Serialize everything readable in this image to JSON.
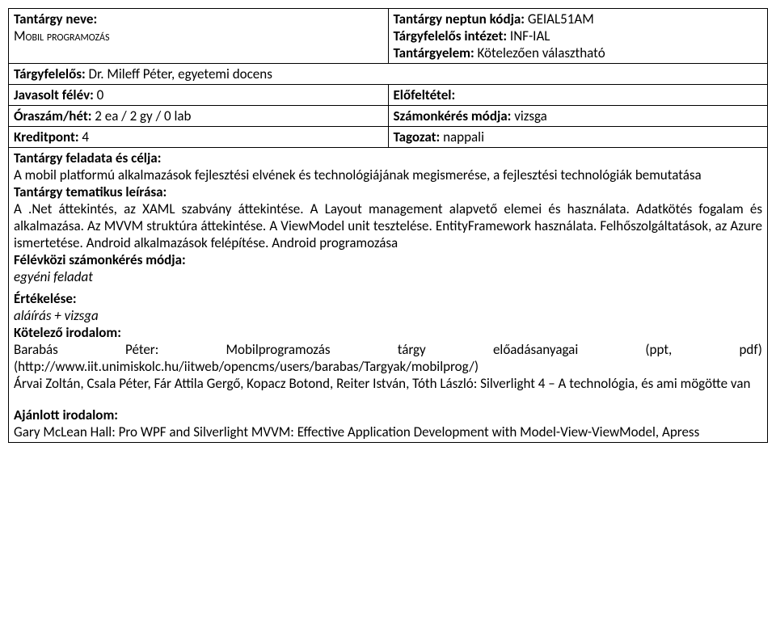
{
  "row1": {
    "left": {
      "name_label": "Tantárgy neve:",
      "name_value": "Mobil programozás"
    },
    "right": {
      "neptun_label": "Tantárgy neptun kódja:",
      "neptun_value": " GEIAL51AM",
      "institute_label": "Tárgyfelelős intézet:",
      "institute_value": " INF-IAL",
      "element_label": "Tantárgyelem:",
      "element_value": " Kötelezően választható"
    }
  },
  "row2": {
    "label": "Tárgyfelelős:",
    "value": " Dr. Mileff Péter, egyetemi docens"
  },
  "row3": {
    "left_label": "Javasolt félév:",
    "left_value": " 0",
    "right_label": "Előfeltétel:"
  },
  "row4": {
    "left_label": "Óraszám/hét:",
    "left_value": " 2 ea / 2 gy / 0 lab",
    "right_label": "Számonkérés módja:",
    "right_value": " vizsga"
  },
  "row5": {
    "left_label": "Kreditpont:",
    "left_value": " 4",
    "right_label": "Tagozat:",
    "right_value": " nappali"
  },
  "row6": {
    "task_label": "Tantárgy feladata és célja:",
    "task_text": "A mobil platformú alkalmazások fejlesztési elvének és technológiájának megismerése, a fejlesztési technológiák bemutatása",
    "topic_label": "Tantárgy tematikus leírása:",
    "topic_text": "A .Net áttekintés, az XAML szabvány áttekintése. A Layout management alapvető elemei és használata. Adatkötés fogalam és alkalmazása. Az MVVM struktúra áttekintése. A ViewModel unit tesztelése. EntityFramework használata. Felhőszolgáltatások, az Azure ismertetése. Android alkalmazások felépítése. Android programozása",
    "midterm_label": "Félévközi számonkérés módja:",
    "midterm_value": "egyéni feladat",
    "grading_label": "Értékelése:",
    "grading_value": "aláírás + vizsga",
    "mandatory_label": "Kötelező irodalom:",
    "lit1_a": "Barabás",
    "lit1_b": "Péter:",
    "lit1_c": "Mobilprogramozás",
    "lit1_d": "tárgy",
    "lit1_e": "előadásanyagai",
    "lit1_f": "(ppt,",
    "lit1_g": "pdf)",
    "lit1_url": "(http://www.iit.unimiskolc.hu/iitweb/opencms/users/barabas/Targyak/mobilprog/)",
    "lit2": "Árvai Zoltán, Csala Péter, Fár Attila Gergő, Kopacz Botond, Reiter István, Tóth László: Silverlight 4 – A technológia, és ami mögötte van",
    "recommended_label": "Ajánlott irodalom:",
    "recommended_text": "Gary McLean Hall: Pro WPF and Silverlight MVVM: Effective Application Development with Model-View-ViewModel, Apress"
  }
}
